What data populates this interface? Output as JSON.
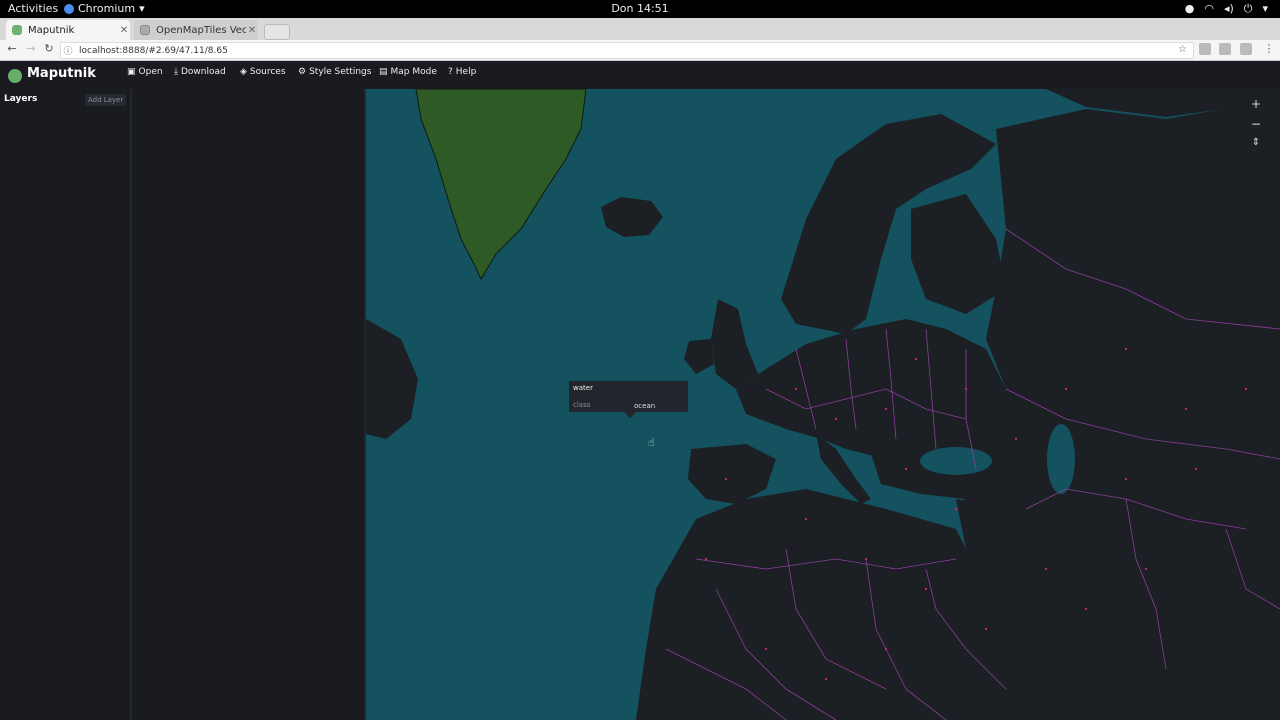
{
  "system_bar": {
    "activities": "Activities",
    "app_name": "Chromium",
    "clock": "Don 14:51"
  },
  "browser": {
    "tabs": [
      {
        "label": "Maputnik",
        "active": true
      },
      {
        "label": "OpenMapTiles Vect",
        "active": false
      }
    ],
    "url": "localhost:8888/#2.69/47.11/8.65"
  },
  "app": {
    "title": "Maputnik",
    "menu": [
      {
        "icon": "open-icon",
        "label": "Open"
      },
      {
        "icon": "download-icon",
        "label": "Download"
      },
      {
        "icon": "sources-icon",
        "label": "Sources"
      },
      {
        "icon": "gear-icon",
        "label": "Style Settings"
      },
      {
        "icon": "map-mode-icon",
        "label": "Map Mode"
      },
      {
        "icon": "help-icon",
        "label": "Help"
      }
    ],
    "layers_title": "Layers",
    "add_layer": "Add Layer"
  },
  "map": {
    "popup": {
      "title": "water",
      "key": "class",
      "value": "ocean"
    },
    "zoom_in": "+",
    "zoom_out": "−",
    "compass": "⇕",
    "colors": {
      "water": "#13525e",
      "land": "#1c1f24",
      "greenland": "#2e5a25",
      "borders": "#8a3f9a"
    }
  }
}
